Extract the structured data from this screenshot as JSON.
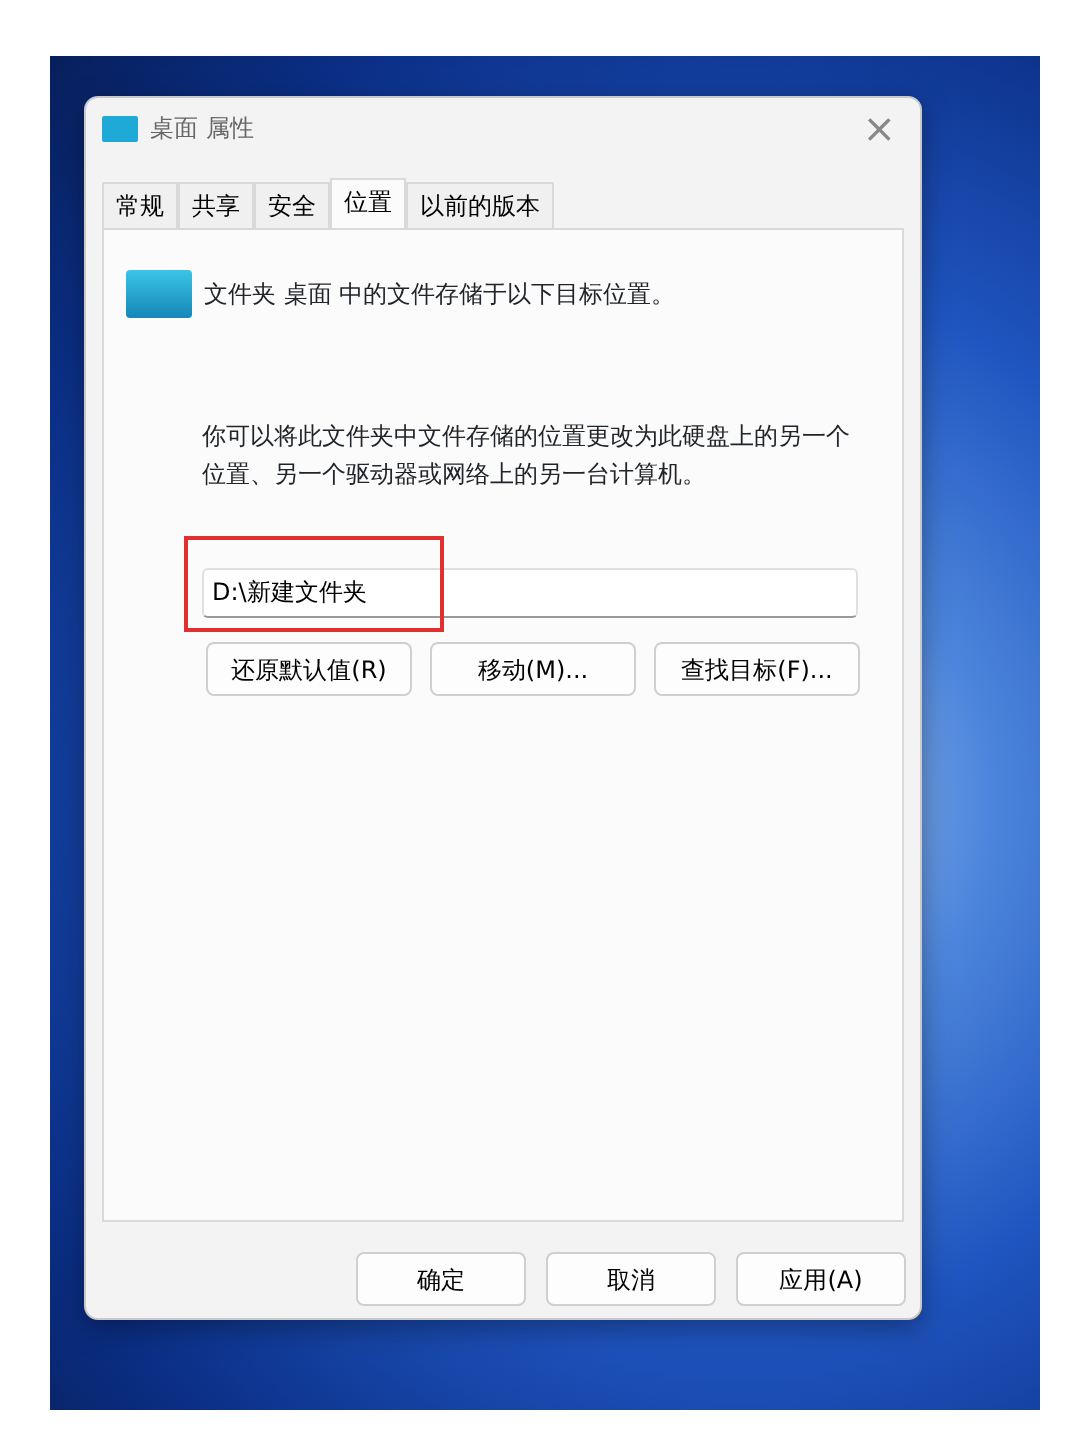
{
  "window": {
    "title": "桌面 属性",
    "close": "×"
  },
  "tabs": [
    {
      "label": "常规",
      "selected": false
    },
    {
      "label": "共享",
      "selected": false
    },
    {
      "label": "安全",
      "selected": false
    },
    {
      "label": "位置",
      "selected": true
    },
    {
      "label": "以前的版本",
      "selected": false
    }
  ],
  "header_text": "文件夹 桌面 中的文件存储于以下目标位置。",
  "description": "你可以将此文件夹中文件存储的位置更改为此硬盘上的另一个位置、另一个驱动器或网络上的另一台计算机。",
  "path_field": {
    "value": "D:\\新建文件夹",
    "highlighted": true
  },
  "location_buttons": [
    "还原默认值(R)",
    "移动(M)...",
    "查找目标(F)..."
  ],
  "footer_buttons": [
    "确定",
    "取消",
    "应用(A)"
  ]
}
